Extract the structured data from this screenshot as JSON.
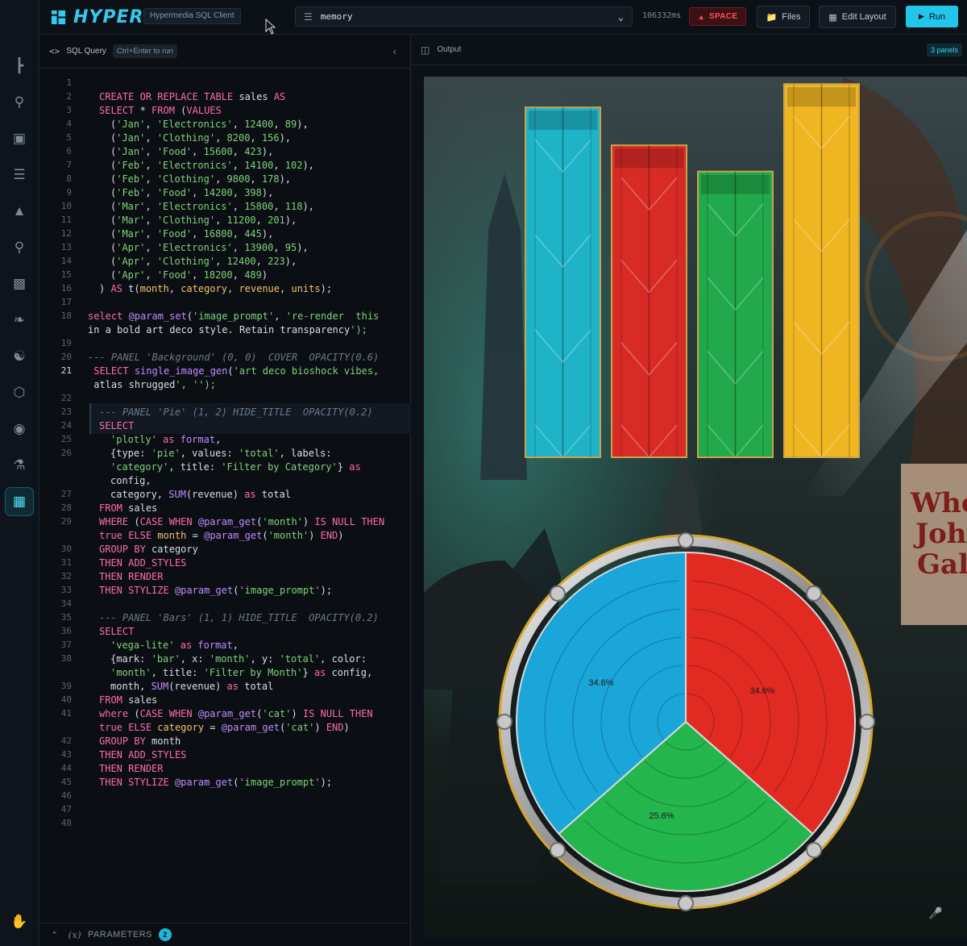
{
  "app": {
    "name": "HYPER",
    "subtitle": "Hypermedia SQL Client"
  },
  "topbar": {
    "database": "memory",
    "elapsed": "106332ms",
    "space_label": "SPACE",
    "files_label": "Files",
    "edit_layout_label": "Edit Layout",
    "run_label": "Run"
  },
  "rail": {
    "icons": [
      "tree-icon",
      "database-search-icon",
      "image-icon",
      "list-icon",
      "graduation-cap-icon",
      "database-search-icon",
      "terminal-icon",
      "rabbit-icon",
      "hierarchy-icon",
      "cube-icon",
      "eye-icon",
      "flask-icon",
      "dashboard-icon"
    ],
    "bottom_icon": "hand-icon"
  },
  "editor": {
    "title": "SQL Query",
    "shortcut": "Ctrl+Enter to run",
    "current_line": 21,
    "params_label": "PARAMETERS",
    "params_count": "2",
    "lines": [
      {
        "n": 1,
        "indent": 0,
        "t": ""
      },
      {
        "n": 2,
        "indent": 1,
        "t": "CREATE OR REPLACE TABLE sales AS"
      },
      {
        "n": 3,
        "indent": 1,
        "t": "SELECT * FROM (VALUES"
      },
      {
        "n": 4,
        "indent": 2,
        "t": "('Jan', 'Electronics', 12400, 89),"
      },
      {
        "n": 5,
        "indent": 2,
        "t": "('Jan', 'Clothing', 8200, 156),"
      },
      {
        "n": 6,
        "indent": 2,
        "t": "('Jan', 'Food', 15600, 423),"
      },
      {
        "n": 7,
        "indent": 2,
        "t": "('Feb', 'Electronics', 14100, 102),"
      },
      {
        "n": 8,
        "indent": 2,
        "t": "('Feb', 'Clothing', 9800, 178),"
      },
      {
        "n": 9,
        "indent": 2,
        "t": "('Feb', 'Food', 14200, 398),"
      },
      {
        "n": 10,
        "indent": 2,
        "t": "('Mar', 'Electronics', 15800, 118),"
      },
      {
        "n": 11,
        "indent": 2,
        "t": "('Mar', 'Clothing', 11200, 201),"
      },
      {
        "n": 12,
        "indent": 2,
        "t": "('Mar', 'Food', 16800, 445),"
      },
      {
        "n": 13,
        "indent": 2,
        "t": "('Apr', 'Electronics', 13900, 95),"
      },
      {
        "n": 14,
        "indent": 2,
        "t": "('Apr', 'Clothing', 12400, 223),"
      },
      {
        "n": 15,
        "indent": 2,
        "t": "('Apr', 'Food', 18200, 489)"
      },
      {
        "n": 16,
        "indent": 1,
        "t": ") AS t(month, category, revenue, units);"
      },
      {
        "n": 17,
        "indent": 0,
        "t": ""
      },
      {
        "n": 18,
        "indent": 0,
        "t": "select @param_set('image_prompt', 're-render  this"
      },
      {
        "n": null,
        "indent": 0,
        "t": "in a bold art deco style. Retain transparency');"
      },
      {
        "n": 19,
        "indent": 0,
        "t": ""
      },
      {
        "n": 20,
        "indent": 0,
        "t": "--- PANEL 'Background' (0, 0)  COVER  OPACITY(0.6)"
      },
      {
        "n": 21,
        "indent": 0,
        "t": " SELECT single_image_gen('art deco bioshock vibes,"
      },
      {
        "n": null,
        "indent": 0,
        "t": " atlas shrugged', '');"
      },
      {
        "n": 22,
        "indent": 0,
        "t": ""
      },
      {
        "n": 23,
        "indent": 1,
        "t": "--- PANEL 'Pie' (1, 2) HIDE_TITLE  OPACITY(0.2)"
      },
      {
        "n": 24,
        "indent": 1,
        "t": "SELECT"
      },
      {
        "n": 25,
        "indent": 2,
        "t": "'plotly' as format,"
      },
      {
        "n": 26,
        "indent": 2,
        "t": "{type: 'pie', values: 'total', labels:"
      },
      {
        "n": null,
        "indent": 2,
        "t": "'category', title: 'Filter by Category'} as"
      },
      {
        "n": null,
        "indent": 2,
        "t": "config,"
      },
      {
        "n": 27,
        "indent": 2,
        "t": "category, SUM(revenue) as total"
      },
      {
        "n": 28,
        "indent": 1,
        "t": "FROM sales"
      },
      {
        "n": 29,
        "indent": 1,
        "t": "WHERE (CASE WHEN @param_get('month') IS NULL THEN"
      },
      {
        "n": null,
        "indent": 1,
        "t": "true ELSE month = @param_get('month') END)"
      },
      {
        "n": 30,
        "indent": 1,
        "t": "GROUP BY category"
      },
      {
        "n": 31,
        "indent": 1,
        "t": "THEN ADD_STYLES"
      },
      {
        "n": 32,
        "indent": 1,
        "t": "THEN RENDER"
      },
      {
        "n": 33,
        "indent": 1,
        "t": "THEN STYLIZE @param_get('image_prompt');"
      },
      {
        "n": 34,
        "indent": 0,
        "t": ""
      },
      {
        "n": 35,
        "indent": 1,
        "t": "--- PANEL 'Bars' (1, 1) HIDE_TITLE  OPACITY(0.2)"
      },
      {
        "n": 36,
        "indent": 1,
        "t": "SELECT"
      },
      {
        "n": 37,
        "indent": 2,
        "t": "'vega-lite' as format,"
      },
      {
        "n": 38,
        "indent": 2,
        "t": "{mark: 'bar', x: 'month', y: 'total', color:"
      },
      {
        "n": null,
        "indent": 2,
        "t": "'month', title: 'Filter by Month'} as config,"
      },
      {
        "n": 39,
        "indent": 2,
        "t": "month, SUM(revenue) as total"
      },
      {
        "n": 40,
        "indent": 1,
        "t": "FROM sales"
      },
      {
        "n": 41,
        "indent": 1,
        "t": "where (CASE WHEN @param_get('cat') IS NULL THEN"
      },
      {
        "n": null,
        "indent": 1,
        "t": "true ELSE category = @param_get('cat') END)"
      },
      {
        "n": 42,
        "indent": 1,
        "t": "GROUP BY month"
      },
      {
        "n": 43,
        "indent": 1,
        "t": "THEN ADD_STYLES"
      },
      {
        "n": 44,
        "indent": 1,
        "t": "THEN RENDER"
      },
      {
        "n": 45,
        "indent": 1,
        "t": "THEN STYLIZE @param_get('image_prompt');"
      },
      {
        "n": 46,
        "indent": 0,
        "t": ""
      },
      {
        "n": 47,
        "indent": 0,
        "t": ""
      },
      {
        "n": 48,
        "indent": 0,
        "t": ""
      }
    ]
  },
  "output": {
    "title": "Output",
    "panels_badge": "3 panels",
    "poster_text": [
      "Who",
      "Joh",
      "Gal"
    ]
  },
  "colors": {
    "accent": "#23c6ea",
    "space_red": "#ff4d5a",
    "bar_teal": "#1fb3c8",
    "bar_red": "#d92b26",
    "bar_green": "#22a94b",
    "bar_gold": "#efb621",
    "pie_blue": "#1aa6d9",
    "pie_red": "#e12a22",
    "pie_green": "#24b54d"
  },
  "chart_data": [
    {
      "type": "bar",
      "categories": [
        "",
        "",
        "",
        ""
      ],
      "values": [
        12,
        10.7,
        9.8,
        12.8
      ],
      "ylim": [
        0,
        13
      ],
      "colors": [
        "#1fb3c8",
        "#d92b26",
        "#22a94b",
        "#efb621"
      ],
      "title": "",
      "xlabel": "",
      "ylabel": "",
      "axes_visible": false
    },
    {
      "type": "pie",
      "labels": [
        "",
        "",
        ""
      ],
      "values": [
        34.6,
        34.6,
        25.6
      ],
      "data_labels": [
        "34.6%",
        "34.6%",
        "25.6%"
      ],
      "colors": [
        "#e12a22",
        "#1aa6d9",
        "#24b54d"
      ],
      "title": ""
    }
  ]
}
